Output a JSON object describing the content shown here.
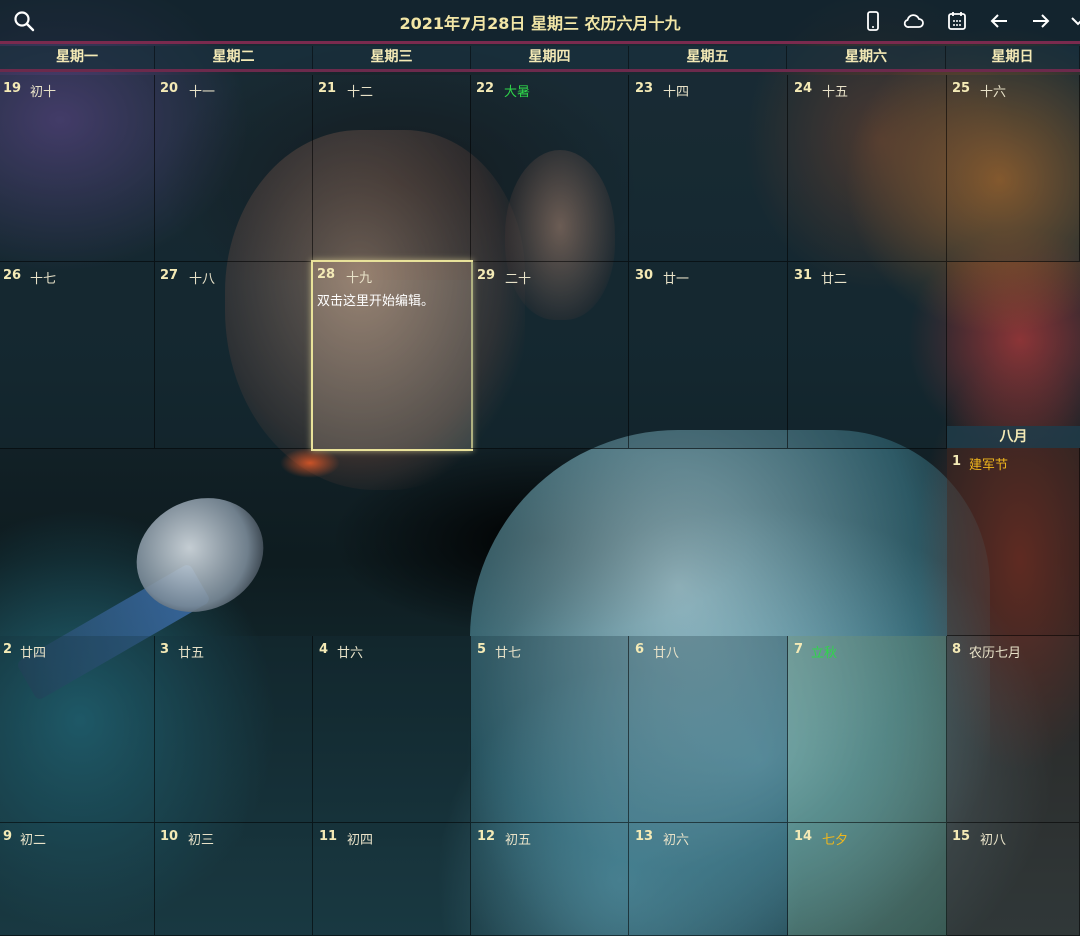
{
  "header": {
    "title": "2021年7月28日 星期三 农历六月十九"
  },
  "weekdays": [
    "星期一",
    "星期二",
    "星期三",
    "星期四",
    "星期五",
    "星期六",
    "星期日"
  ],
  "month_label": "八月",
  "selected_note": "双击这里开始编辑。",
  "week1": [
    {
      "day": "19",
      "lunar": "初十",
      "color": "normal"
    },
    {
      "day": "20",
      "lunar": "十一",
      "color": "normal"
    },
    {
      "day": "21",
      "lunar": "十二",
      "color": "normal"
    },
    {
      "day": "22",
      "lunar": "大暑",
      "color": "green"
    },
    {
      "day": "23",
      "lunar": "十四",
      "color": "normal"
    },
    {
      "day": "24",
      "lunar": "十五",
      "color": "normal"
    },
    {
      "day": "25",
      "lunar": "十六",
      "color": "normal"
    }
  ],
  "week2": [
    {
      "day": "26",
      "lunar": "十七",
      "color": "normal"
    },
    {
      "day": "27",
      "lunar": "十八",
      "color": "normal"
    },
    {
      "day": "28",
      "lunar": "十九",
      "color": "normal"
    },
    {
      "day": "29",
      "lunar": "二十",
      "color": "normal"
    },
    {
      "day": "30",
      "lunar": "廿一",
      "color": "normal"
    },
    {
      "day": "31",
      "lunar": "廿二",
      "color": "normal"
    }
  ],
  "aug1": {
    "day": "1",
    "lunar": "建军节",
    "color": "gold"
  },
  "week4": [
    {
      "day": "2",
      "lunar": "廿四",
      "color": "normal"
    },
    {
      "day": "3",
      "lunar": "廿五",
      "color": "normal"
    },
    {
      "day": "4",
      "lunar": "廿六",
      "color": "normal"
    },
    {
      "day": "5",
      "lunar": "廿七",
      "color": "normal"
    },
    {
      "day": "6",
      "lunar": "廿八",
      "color": "normal"
    },
    {
      "day": "7",
      "lunar": "立秋",
      "color": "green"
    },
    {
      "day": "8",
      "lunar": "农历七月",
      "color": "normal"
    }
  ],
  "week5": [
    {
      "day": "9",
      "lunar": "初二",
      "color": "normal"
    },
    {
      "day": "10",
      "lunar": "初三",
      "color": "normal"
    },
    {
      "day": "11",
      "lunar": "初四",
      "color": "normal"
    },
    {
      "day": "12",
      "lunar": "初五",
      "color": "normal"
    },
    {
      "day": "13",
      "lunar": "初六",
      "color": "normal"
    },
    {
      "day": "14",
      "lunar": "七夕",
      "color": "gold"
    },
    {
      "day": "15",
      "lunar": "初八",
      "color": "normal"
    }
  ],
  "icons": [
    "search-icon",
    "phone-icon",
    "cloud-icon",
    "calendar-icon",
    "arrow-left-icon",
    "arrow-right-icon",
    "chevron-down-icon"
  ],
  "colors": {
    "accent": "#f2e6a6",
    "holiday_gold": "#f0b71c",
    "solar_term_green": "#2fd64a",
    "divider": "#7a2a4e"
  }
}
